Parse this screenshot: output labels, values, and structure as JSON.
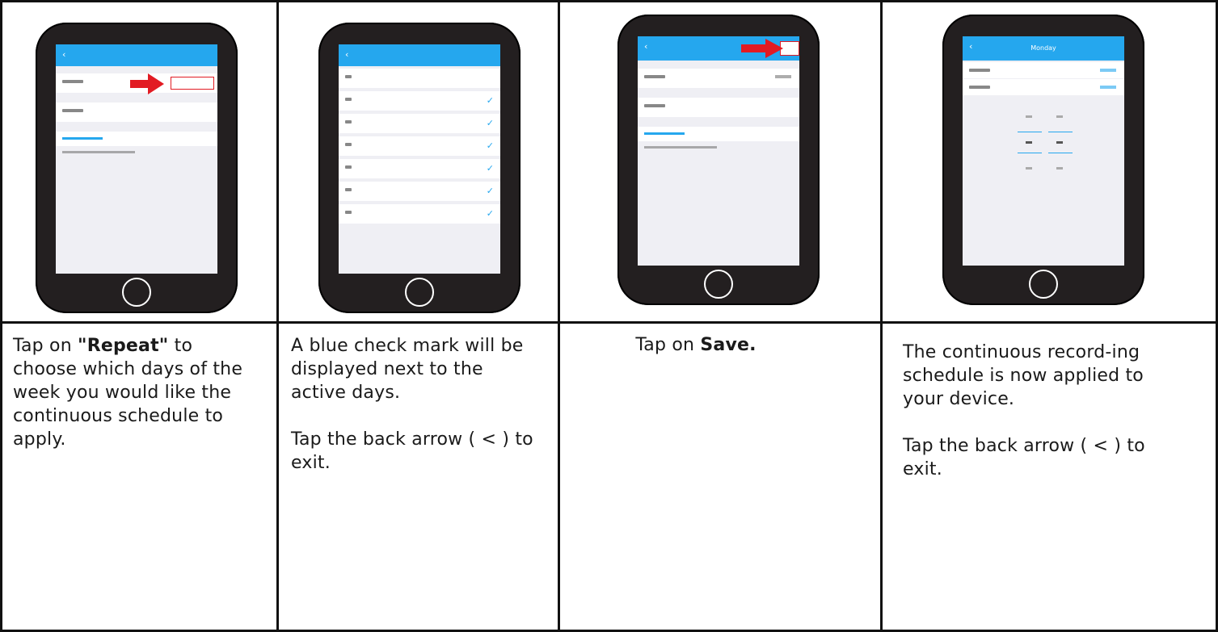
{
  "steps": [
    {
      "text_html": "Tap on <b>\"Repeat\"</b> to choose which days of the week you would like the continuous schedule to apply."
    },
    {
      "text_1": "A blue check mark will be displayed next to the active days.",
      "text_2": "Tap the back arrow ( < ) to exit."
    },
    {
      "text_html": "Tap on <b>Save.</b>"
    },
    {
      "text_1": "The continuous record-ing schedule is now applied to your device.",
      "text_2": "Tap the back arrow ( < ) to exit."
    }
  ],
  "phone4_title": "Monday",
  "colors": {
    "accent": "#25a7ee",
    "highlight": "#e21b23",
    "phone_body": "#231f20"
  }
}
